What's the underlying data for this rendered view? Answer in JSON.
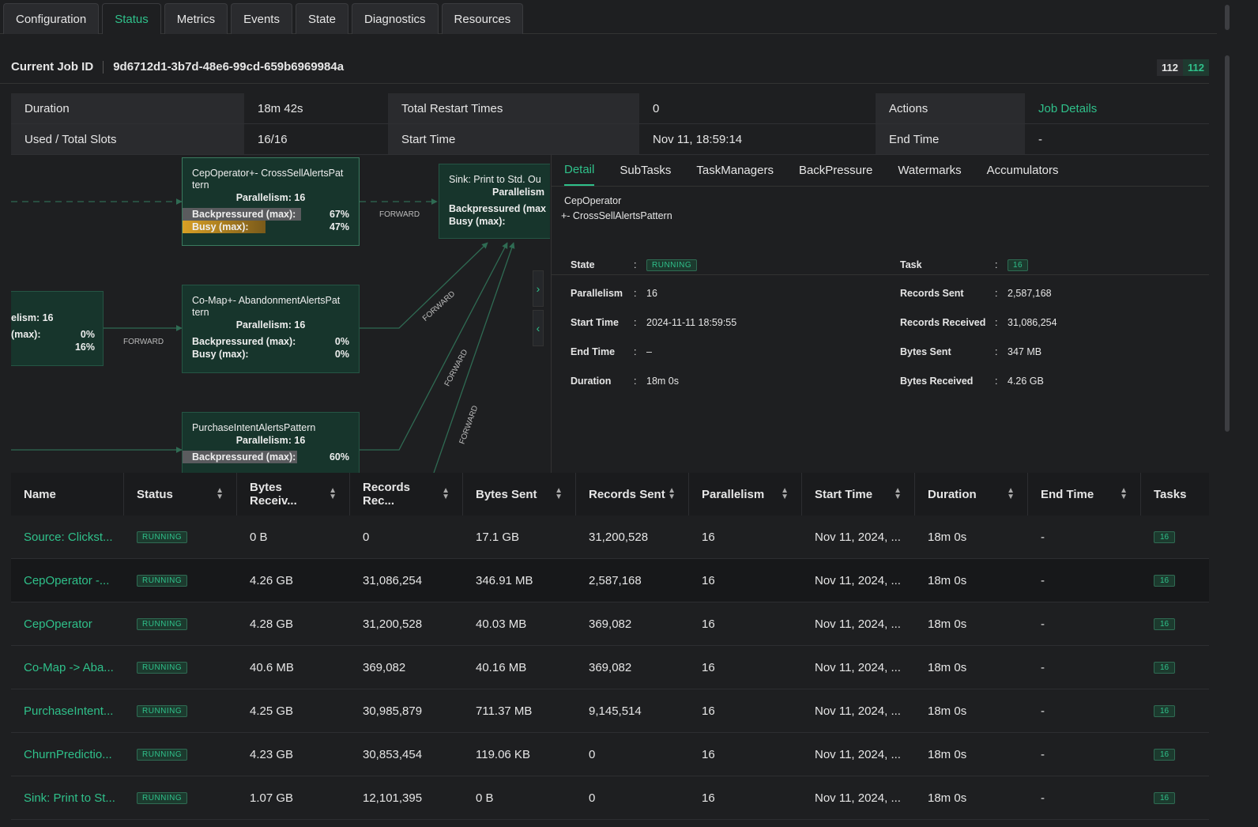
{
  "tabs": [
    "Configuration",
    "Status",
    "Metrics",
    "Events",
    "State",
    "Diagnostics",
    "Resources"
  ],
  "active_tab": "Status",
  "job": {
    "label": "Current Job ID",
    "id": "9d6712d1-3b7d-48e6-99cd-659b6969984a",
    "counts": [
      "112",
      "112"
    ]
  },
  "info": {
    "duration_label": "Duration",
    "duration": "18m 42s",
    "restart_label": "Total Restart Times",
    "restart": "0",
    "actions_label": "Actions",
    "actions_link": "Job Details",
    "slots_label": "Used / Total Slots",
    "slots": "16/16",
    "start_label": "Start Time",
    "start": "Nov 11, 18:59:14",
    "end_label": "End Time",
    "end": "-"
  },
  "graph": {
    "nodes": {
      "left": {
        "parallelism": "elism: 16",
        "m1": "(max):",
        "v1": "0%",
        "v2": "16%"
      },
      "cep_cross": {
        "title": "CepOperator+- CrossSellAlertsPat tern",
        "parallelism": "Parallelism: 16",
        "bp_label": "Backpressured (max):",
        "bp": "67%",
        "busy_label": "Busy (max):",
        "busy": "47%"
      },
      "comap": {
        "title": "Co-Map+- AbandonmentAlertsPat tern",
        "parallelism": "Parallelism: 16",
        "bp_label": "Backpressured (max):",
        "bp": "0%",
        "busy_label": "Busy (max):",
        "busy": "0%"
      },
      "purchase": {
        "title": "PurchaseIntentAlertsPattern",
        "parallelism": "Parallelism: 16",
        "bp_label": "Backpressured (max):",
        "bp": "60%"
      },
      "sink": {
        "title": "Sink: Print to Std. Ou",
        "parallelism": "Parallelism",
        "bp_label": "Backpressured (max",
        "busy_label": "Busy (max):"
      }
    },
    "edge_label": "FORWARD"
  },
  "detail": {
    "tabs": [
      "Detail",
      "SubTasks",
      "TaskManagers",
      "BackPressure",
      "Watermarks",
      "Accumulators"
    ],
    "active_tab": "Detail",
    "operator_line1": "CepOperator",
    "operator_line2": "+- CrossSellAlertsPattern",
    "left": [
      {
        "k": "State",
        "v": "RUNNING",
        "badge": true
      },
      {
        "k": "Parallelism",
        "v": "16"
      },
      {
        "k": "Start Time",
        "v": "2024-11-11 18:59:55"
      },
      {
        "k": "End Time",
        "v": "–"
      },
      {
        "k": "Duration",
        "v": "18m 0s"
      }
    ],
    "right": [
      {
        "k": "Task",
        "v": "16",
        "badge": true
      },
      {
        "k": "Records Sent",
        "v": "2,587,168"
      },
      {
        "k": "Records Received",
        "v": "31,086,254"
      },
      {
        "k": "Bytes Sent",
        "v": "347 MB"
      },
      {
        "k": "Bytes Received",
        "v": "4.26 GB"
      }
    ]
  },
  "table": {
    "headers": [
      "Name",
      "Status",
      "Bytes Receiv...",
      "Records Rec...",
      "Bytes Sent",
      "Records Sent",
      "Parallelism",
      "Start Time",
      "Duration",
      "End Time",
      "Tasks"
    ],
    "rows": [
      [
        "Source: Clickst...",
        "RUNNING",
        "0 B",
        "0",
        "17.1 GB",
        "31,200,528",
        "16",
        "Nov 11, 2024, ...",
        "18m 0s",
        "-",
        "16"
      ],
      [
        "CepOperator -...",
        "RUNNING",
        "4.26 GB",
        "31,086,254",
        "346.91 MB",
        "2,587,168",
        "16",
        "Nov 11, 2024, ...",
        "18m 0s",
        "-",
        "16"
      ],
      [
        "CepOperator",
        "RUNNING",
        "4.28 GB",
        "31,200,528",
        "40.03 MB",
        "369,082",
        "16",
        "Nov 11, 2024, ...",
        "18m 0s",
        "-",
        "16"
      ],
      [
        "Co-Map -> Aba...",
        "RUNNING",
        "40.6 MB",
        "369,082",
        "40.16 MB",
        "369,082",
        "16",
        "Nov 11, 2024, ...",
        "18m 0s",
        "-",
        "16"
      ],
      [
        "PurchaseIntent...",
        "RUNNING",
        "4.25 GB",
        "30,985,879",
        "711.37 MB",
        "9,145,514",
        "16",
        "Nov 11, 2024, ...",
        "18m 0s",
        "-",
        "16"
      ],
      [
        "ChurnPredictio...",
        "RUNNING",
        "4.23 GB",
        "30,853,454",
        "119.06 KB",
        "0",
        "16",
        "Nov 11, 2024, ...",
        "18m 0s",
        "-",
        "16"
      ],
      [
        "Sink: Print to St...",
        "RUNNING",
        "1.07 GB",
        "12,101,395",
        "0 B",
        "0",
        "16",
        "Nov 11, 2024, ...",
        "18m 0s",
        "-",
        "16"
      ]
    ]
  },
  "colors": {
    "accent": "#2fc08a",
    "node_bg": "#17352c",
    "busy": "#d8a025",
    "bp": "#666666"
  }
}
